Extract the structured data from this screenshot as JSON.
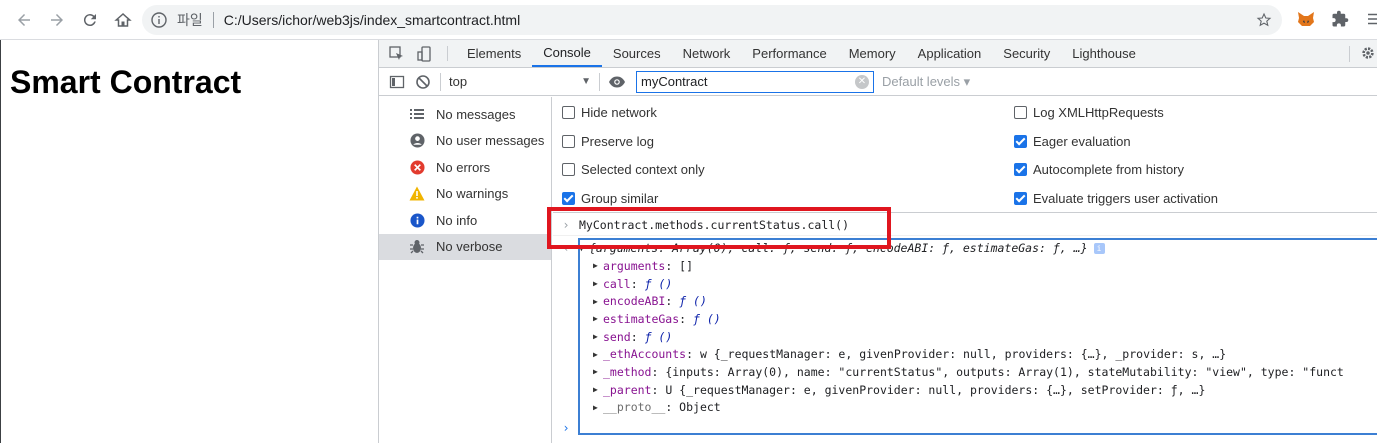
{
  "browser": {
    "file_label": "파일",
    "url": "C:/Users/ichor/web3js/index_smartcontract.html"
  },
  "page": {
    "heading": "Smart Contract"
  },
  "devtools": {
    "tabs": [
      "Elements",
      "Console",
      "Sources",
      "Network",
      "Performance",
      "Memory",
      "Application",
      "Security",
      "Lighthouse"
    ],
    "active_tab": "Console",
    "context": "top",
    "filter_value": "myContract",
    "levels": "Default levels ▾",
    "sidebar": [
      {
        "label": "No messages",
        "icon": "list-icon"
      },
      {
        "label": "No user messages",
        "icon": "user-icon"
      },
      {
        "label": "No errors",
        "icon": "error-icon"
      },
      {
        "label": "No warnings",
        "icon": "warning-icon"
      },
      {
        "label": "No info",
        "icon": "info-icon"
      },
      {
        "label": "No verbose",
        "icon": "bug-icon"
      }
    ],
    "settings_left": [
      {
        "label": "Hide network",
        "checked": false
      },
      {
        "label": "Preserve log",
        "checked": false
      },
      {
        "label": "Selected context only",
        "checked": false
      },
      {
        "label": "Group similar",
        "checked": true
      }
    ],
    "settings_right": [
      {
        "label": "Log XMLHttpRequests",
        "checked": false
      },
      {
        "label": "Eager evaluation",
        "checked": true
      },
      {
        "label": "Autocomplete from history",
        "checked": true
      },
      {
        "label": "Evaluate triggers user activation",
        "checked": true
      }
    ],
    "console": {
      "input": "MyContract.methods.currentStatus.call()",
      "result_summary": "{arguments: Array(0), call: ƒ, send: ƒ, encodeABI: ƒ, estimateGas: ƒ, …}",
      "rows": [
        {
          "key": "arguments",
          "value": "[]"
        },
        {
          "key": "call",
          "value": "ƒ ()"
        },
        {
          "key": "encodeABI",
          "value": "ƒ ()"
        },
        {
          "key": "estimateGas",
          "value": "ƒ ()"
        },
        {
          "key": "send",
          "value": "ƒ ()"
        },
        {
          "key": "_ethAccounts",
          "value": "w {_requestManager: e, givenProvider: null, providers: {…}, _provider: s, …}"
        },
        {
          "key": "_method",
          "value": "{inputs: Array(0), name: \"currentStatus\", outputs: Array(1), stateMutability: \"view\", type: \"funct"
        },
        {
          "key": "_parent",
          "value": "U {_requestManager: e, givenProvider: null, providers: {…}, setProvider: ƒ, …}"
        },
        {
          "key": "__proto__",
          "value": "Object"
        }
      ]
    }
  }
}
